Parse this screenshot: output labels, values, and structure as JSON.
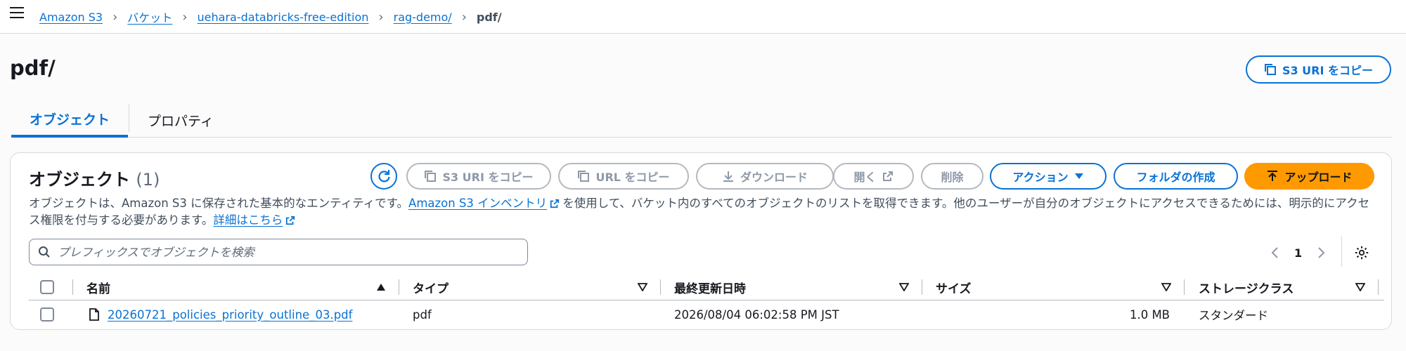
{
  "breadcrumb": {
    "items": [
      "Amazon S3",
      "バケット",
      "uehara-databricks-free-edition",
      "rag-demo/"
    ],
    "current": "pdf/"
  },
  "header": {
    "title": "pdf/",
    "copy_uri_label": "S3 URI をコピー"
  },
  "tabs": [
    "オブジェクト",
    "プロパティ"
  ],
  "objects_panel": {
    "title": "オブジェクト",
    "count": "(1)",
    "buttons": {
      "copy_s3_uri": "S3 URI をコピー",
      "copy_url": "URL をコピー",
      "download": "ダウンロード",
      "open": "開く",
      "delete": "削除",
      "actions": "アクション",
      "create_folder": "フォルダの作成",
      "upload": "アップロード"
    },
    "description": {
      "part1": "オブジェクトは、Amazon S3 に保存された基本的なエンティティです。",
      "link1": "Amazon S3 インベントリ",
      "part2": "を使用して、バケット内のすべてのオブジェクトのリストを取得できます。他のユーザーが自分のオブジェクトにアクセスできるためには、明示的にアクセス権限を付与する必要があります。",
      "link2": "詳細はこちら"
    },
    "search_placeholder": "プレフィックスでオブジェクトを検索",
    "pagination": {
      "page": "1"
    }
  },
  "table": {
    "columns": [
      "名前",
      "タイプ",
      "最終更新日時",
      "サイズ",
      "ストレージクラス"
    ],
    "rows": [
      {
        "name": "20260721_policies_priority_outline_03.pdf",
        "type": "pdf",
        "modified": "2026/08/04 06:02:58 PM JST",
        "size": "1.0 MB",
        "storage_class": "スタンダード"
      }
    ]
  },
  "colors": {
    "link": "#0972d3",
    "primary_button": "#ff9900",
    "disabled": "#8d99a8"
  }
}
